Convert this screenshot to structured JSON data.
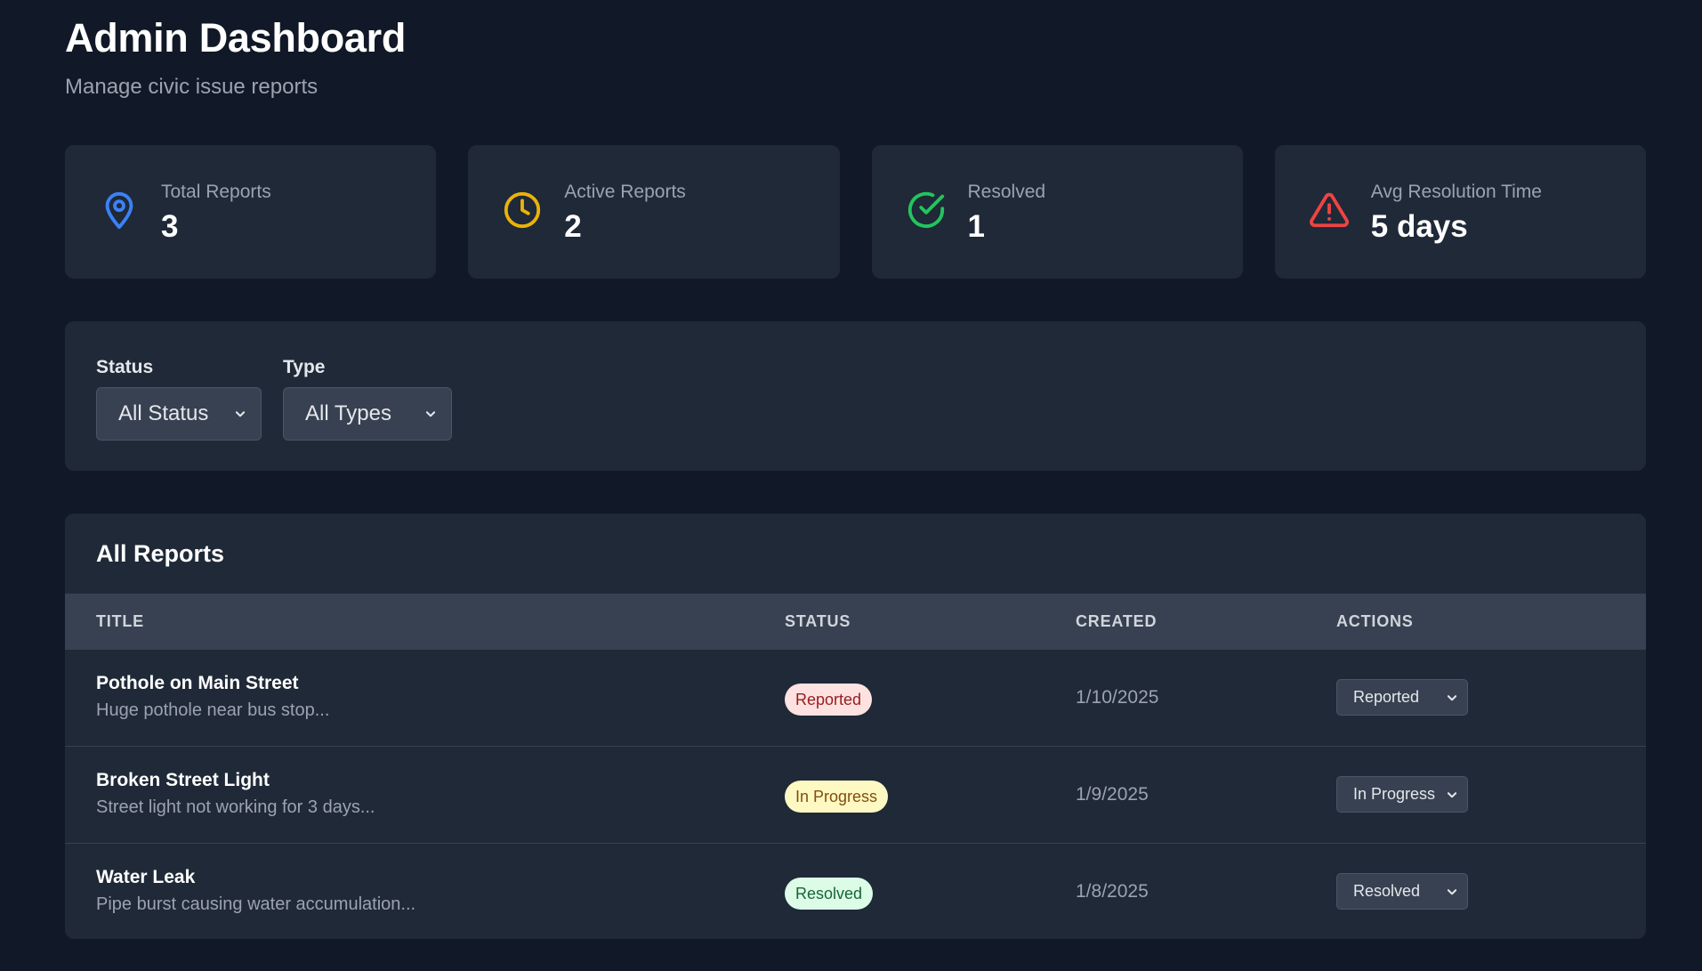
{
  "header": {
    "title": "Admin Dashboard",
    "subtitle": "Manage civic issue reports"
  },
  "stats": [
    {
      "label": "Total Reports",
      "value": "3",
      "icon": "map-pin-icon",
      "color": "#3b82f6"
    },
    {
      "label": "Active Reports",
      "value": "2",
      "icon": "clock-icon",
      "color": "#eab308"
    },
    {
      "label": "Resolved",
      "value": "1",
      "icon": "check-circle-icon",
      "color": "#22c55e"
    },
    {
      "label": "Avg Resolution Time",
      "value": "5 days",
      "icon": "alert-triangle-icon",
      "color": "#ef4444"
    }
  ],
  "filters": {
    "status": {
      "label": "Status",
      "selected": "All Status"
    },
    "type": {
      "label": "Type",
      "selected": "All Types"
    }
  },
  "reports": {
    "title": "All Reports",
    "columns": [
      "TITLE",
      "STATUS",
      "CREATED",
      "ACTIONS"
    ],
    "rows": [
      {
        "title": "Pothole on Main Street",
        "description": "Huge pothole near bus stop...",
        "status": "Reported",
        "created": "1/10/2025",
        "action": "Reported",
        "badge_bg": "#fee2e2",
        "badge_fg": "#991b1b"
      },
      {
        "title": "Broken Street Light",
        "description": "Street light not working for 3 days...",
        "status": "In Progress",
        "created": "1/9/2025",
        "action": "In Progress",
        "badge_bg": "#fef9c3",
        "badge_fg": "#854d0e"
      },
      {
        "title": "Water Leak",
        "description": "Pipe burst causing water accumulation...",
        "status": "Resolved",
        "created": "1/8/2025",
        "action": "Resolved",
        "badge_bg": "#dcfce7",
        "badge_fg": "#166534"
      }
    ]
  }
}
